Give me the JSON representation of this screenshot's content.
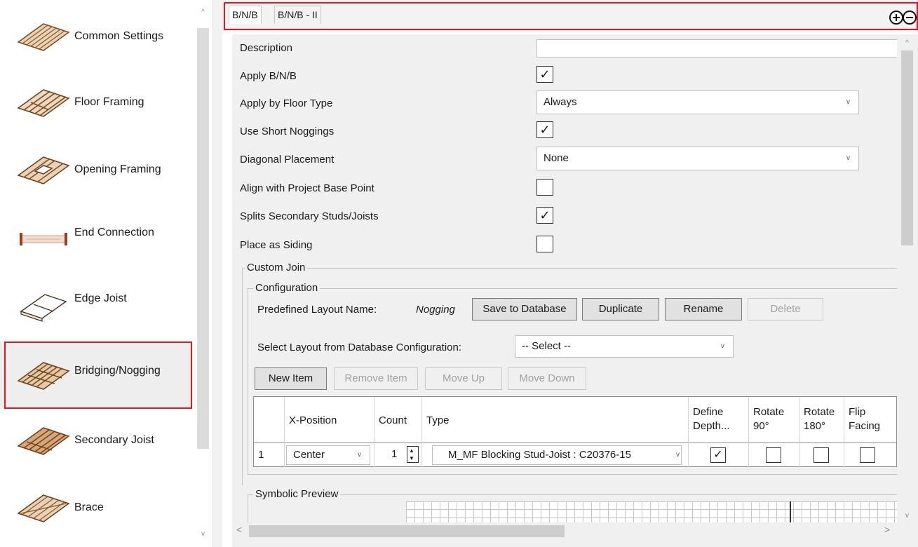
{
  "sidebar": {
    "items": [
      {
        "label": "Common Settings",
        "icon": "floor-deck-icon"
      },
      {
        "label": "Floor Framing",
        "icon": "floor-framing-icon"
      },
      {
        "label": "Opening Framing",
        "icon": "opening-framing-icon"
      },
      {
        "label": "End Connection",
        "icon": "end-connection-icon"
      },
      {
        "label": "Edge Joist",
        "icon": "edge-joist-icon"
      },
      {
        "label": "Bridging/Nogging",
        "icon": "bridging-nogging-icon",
        "selected": true
      },
      {
        "label": "Secondary Joist",
        "icon": "secondary-joist-icon"
      },
      {
        "label": "Brace",
        "icon": "brace-icon"
      }
    ],
    "scroll_up": "^",
    "scroll_down": "v"
  },
  "tabs": {
    "items": [
      "B/N/B",
      "B/N/B - II"
    ],
    "active": 0,
    "add_icon": "circle-plus-icon",
    "remove_icon": "circle-minus-icon"
  },
  "properties": {
    "description": {
      "label": "Description",
      "value": ""
    },
    "apply_bnb": {
      "label": "Apply B/N/B",
      "checked": true
    },
    "apply_by_floor_type": {
      "label": "Apply by Floor Type",
      "value": "Always"
    },
    "use_short_noggings": {
      "label": "Use Short Noggings",
      "checked": true
    },
    "diagonal_placement": {
      "label": "Diagonal Placement",
      "value": "None"
    },
    "align_base_point": {
      "label": "Align with Project Base Point",
      "checked": false
    },
    "splits_secondary": {
      "label": "Splits Secondary Studs/Joists",
      "checked": true
    },
    "place_as_siding": {
      "label": "Place as Siding",
      "checked": false
    }
  },
  "custom_join": {
    "title": "Custom Join",
    "configuration": {
      "title": "Configuration",
      "layout_name_label": "Predefined Layout Name:",
      "layout_name_value": "Nogging",
      "save_to_db": "Save to Database",
      "duplicate": "Duplicate",
      "rename": "Rename",
      "delete": "Delete",
      "select_layout_label": "Select Layout from Database Configuration:",
      "select_layout_value": "-- Select --",
      "new_item": "New Item",
      "remove_item": "Remove Item",
      "move_up": "Move Up",
      "move_down": "Move Down",
      "table": {
        "headers": {
          "x_position": "X-Position",
          "count": "Count",
          "type": "Type",
          "define_depth": "Define\nDepth...",
          "rotate_90": "Rotate\n90°",
          "rotate_180": "Rotate\n180°",
          "flip_facing": "Flip\nFacing"
        },
        "rows": [
          {
            "index": "1",
            "x_position": "Center",
            "count": "1",
            "type": "M_MF Blocking Stud-Joist : C20376-15",
            "define_depth": true,
            "rotate_90": false,
            "rotate_180": false,
            "flip_facing": false
          }
        ]
      }
    }
  },
  "symbolic_preview": {
    "title": "Symbolic Preview"
  },
  "glyphs": {
    "check": "✓",
    "chevron": "v",
    "spin_up": "▲",
    "spin_down": "▼",
    "left_arrow": "<",
    "right_arrow": ">"
  }
}
